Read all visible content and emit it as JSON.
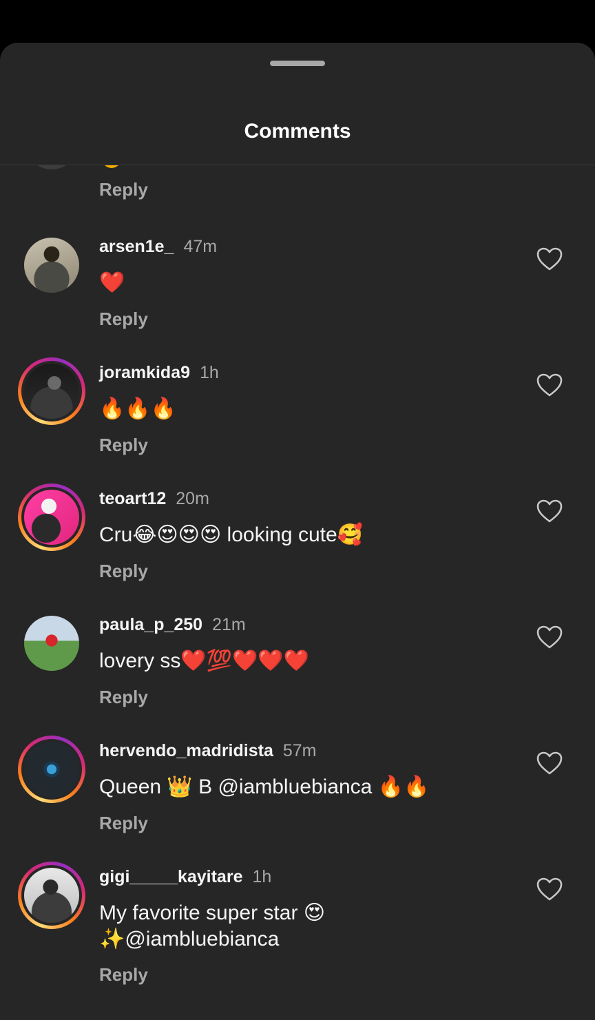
{
  "header": {
    "title": "Comments"
  },
  "top_reply": "Reply",
  "comments": [
    {
      "user": "arsen1e_",
      "time": "47m",
      "text": "❤️",
      "reply": "Reply"
    },
    {
      "user": "joramkida9",
      "time": "1h",
      "text": "🔥🔥🔥",
      "reply": "Reply"
    },
    {
      "user": "teoart12",
      "time": "20m",
      "text": "Cru😂😍😍😍 looking cute🥰",
      "reply": "Reply"
    },
    {
      "user": "paula_p_250",
      "time": "21m",
      "text": "lovery ss❤️💯❤️❤️❤️",
      "reply": "Reply"
    },
    {
      "user": "hervendo_madridista",
      "time": "57m",
      "text": "Queen 👑 B @iambluebianca 🔥🔥",
      "reply": "Reply"
    },
    {
      "user": "gigi_____kayitare",
      "time": "1h",
      "text": "My favorite super star 😍\n✨@iambluebianca",
      "reply": "Reply"
    }
  ],
  "icons": {
    "like": "heart-outline-icon",
    "grabber": "drag-handle"
  },
  "colors": {
    "sheet_bg": "#262626",
    "secondary_text": "#a8a8a8",
    "story_ring": [
      "#feda75",
      "#fa7e1e",
      "#d62976",
      "#962fbf"
    ]
  }
}
